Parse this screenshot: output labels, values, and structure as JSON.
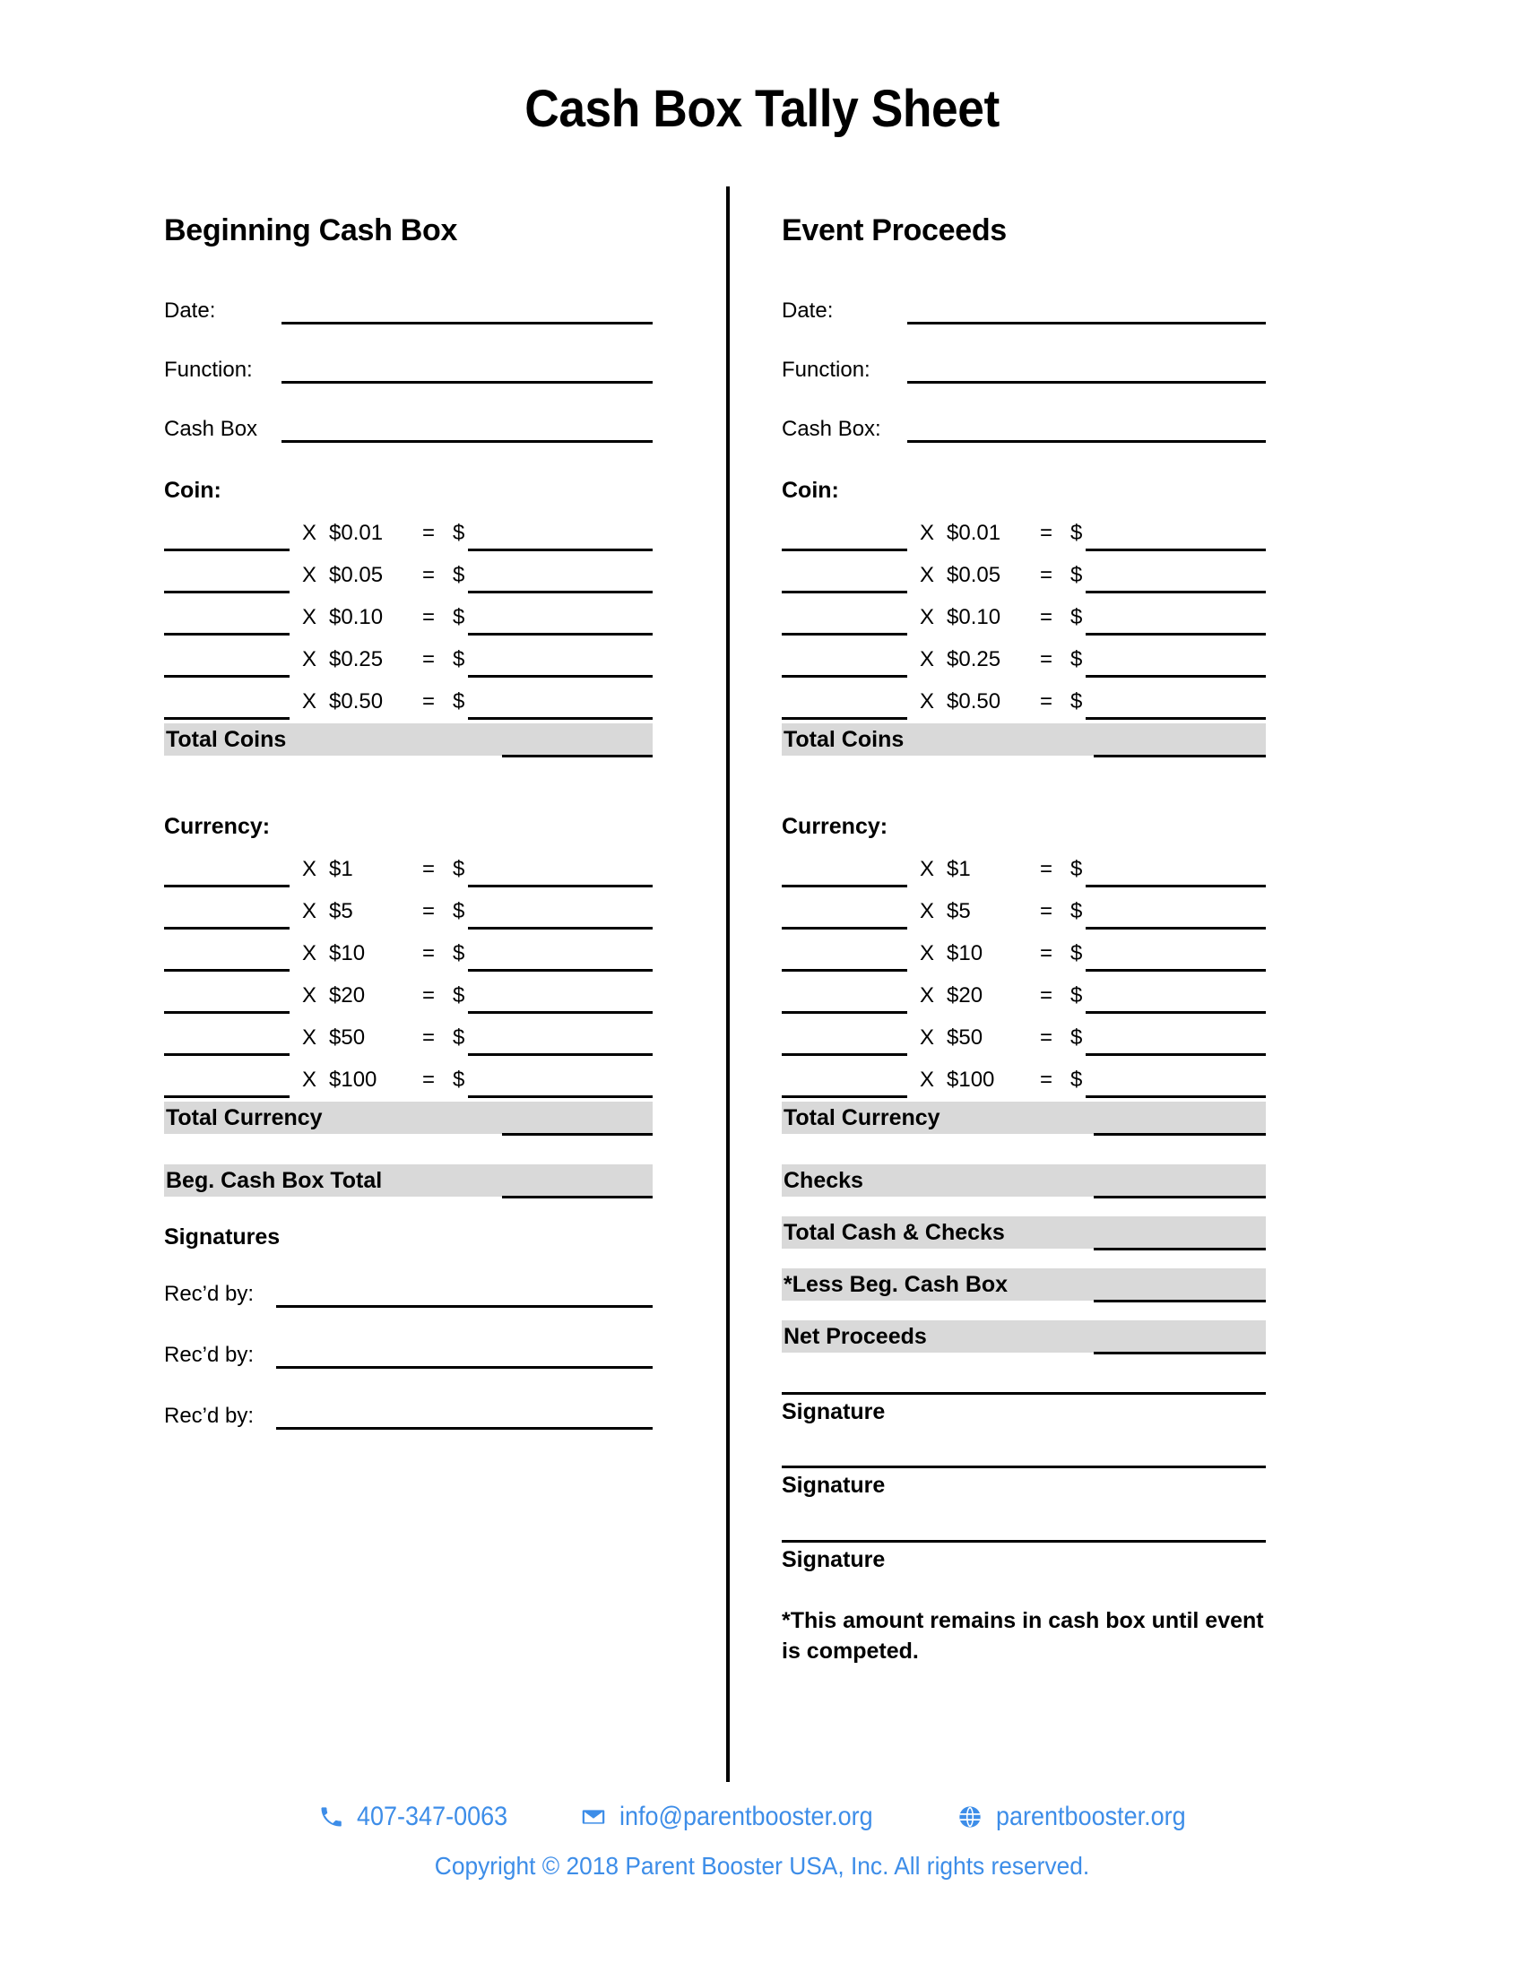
{
  "document": {
    "title": "Cash Box Tally Sheet"
  },
  "left_column": {
    "heading": "Beginning Cash Box",
    "fields": [
      {
        "label": "Date:"
      },
      {
        "label": "Function:"
      },
      {
        "label": "Cash Box"
      }
    ],
    "coin": {
      "heading": "Coin:",
      "rows": [
        {
          "x": "X",
          "denom": "$0.01",
          "eq": "=",
          "currency_symbol": "$"
        },
        {
          "x": "X",
          "denom": "$0.05",
          "eq": "=",
          "currency_symbol": "$"
        },
        {
          "x": "X",
          "denom": "$0.10",
          "eq": "=",
          "currency_symbol": "$"
        },
        {
          "x": "X",
          "denom": "$0.25",
          "eq": "=",
          "currency_symbol": "$"
        },
        {
          "x": "X",
          "denom": "$0.50",
          "eq": "=",
          "currency_symbol": "$"
        }
      ],
      "total_label": "Total Coins"
    },
    "currency": {
      "heading": "Currency:",
      "rows": [
        {
          "x": "X",
          "denom": "$1",
          "eq": "=",
          "currency_symbol": "$"
        },
        {
          "x": "X",
          "denom": "$5",
          "eq": "=",
          "currency_symbol": "$"
        },
        {
          "x": "X",
          "denom": "$10",
          "eq": "=",
          "currency_symbol": "$"
        },
        {
          "x": "X",
          "denom": "$20",
          "eq": "=",
          "currency_symbol": "$"
        },
        {
          "x": "X",
          "denom": "$50",
          "eq": "=",
          "currency_symbol": "$"
        },
        {
          "x": "X",
          "denom": "$100",
          "eq": "=",
          "currency_symbol": "$"
        }
      ],
      "total_label": "Total Currency"
    },
    "grand_total_label": "Beg. Cash Box Total",
    "signatures_heading": "Signatures",
    "signature_lines": [
      {
        "label": "Rec’d by:"
      },
      {
        "label": "Rec’d by:"
      },
      {
        "label": "Rec’d by:"
      }
    ]
  },
  "right_column": {
    "heading": "Event Proceeds",
    "fields": [
      {
        "label": "Date:"
      },
      {
        "label": "Function:"
      },
      {
        "label": "Cash Box:"
      }
    ],
    "coin": {
      "heading": "Coin:",
      "rows": [
        {
          "x": "X",
          "denom": "$0.01",
          "eq": "=",
          "currency_symbol": "$"
        },
        {
          "x": "X",
          "denom": "$0.05",
          "eq": "=",
          "currency_symbol": "$"
        },
        {
          "x": "X",
          "denom": "$0.10",
          "eq": "=",
          "currency_symbol": "$"
        },
        {
          "x": "X",
          "denom": "$0.25",
          "eq": "=",
          "currency_symbol": "$"
        },
        {
          "x": "X",
          "denom": "$0.50",
          "eq": "=",
          "currency_symbol": "$"
        }
      ],
      "total_label": "Total Coins"
    },
    "currency": {
      "heading": "Currency:",
      "rows": [
        {
          "x": "X",
          "denom": "$1",
          "eq": "=",
          "currency_symbol": "$"
        },
        {
          "x": "X",
          "denom": "$5",
          "eq": "=",
          "currency_symbol": "$"
        },
        {
          "x": "X",
          "denom": "$10",
          "eq": "=",
          "currency_symbol": "$"
        },
        {
          "x": "X",
          "denom": "$20",
          "eq": "=",
          "currency_symbol": "$"
        },
        {
          "x": "X",
          "denom": "$50",
          "eq": "=",
          "currency_symbol": "$"
        },
        {
          "x": "X",
          "denom": "$100",
          "eq": "=",
          "currency_symbol": "$"
        }
      ],
      "total_label": "Total Currency"
    },
    "totals": [
      {
        "label": "Checks"
      },
      {
        "label": "Total Cash & Checks"
      },
      {
        "label": "*Less Beg. Cash Box"
      },
      {
        "label": "Net Proceeds"
      }
    ],
    "signature_captions": [
      "Signature",
      "Signature",
      "Signature"
    ],
    "footnote": "*This amount remains in cash box until event is competed."
  },
  "footer": {
    "phone": "407-347-0063",
    "email": "info@parentbooster.org",
    "website": "parentbooster.org",
    "copyright": "Copyright © 2018 Parent Booster USA, Inc. All rights reserved.",
    "accent_color": "#3d8de8",
    "icons": {
      "phone": "phone-icon",
      "email": "envelope-icon",
      "website": "globe-icon"
    }
  },
  "style": {
    "total_bar_color": "#d9d9d9",
    "rule_color": "#000000"
  }
}
